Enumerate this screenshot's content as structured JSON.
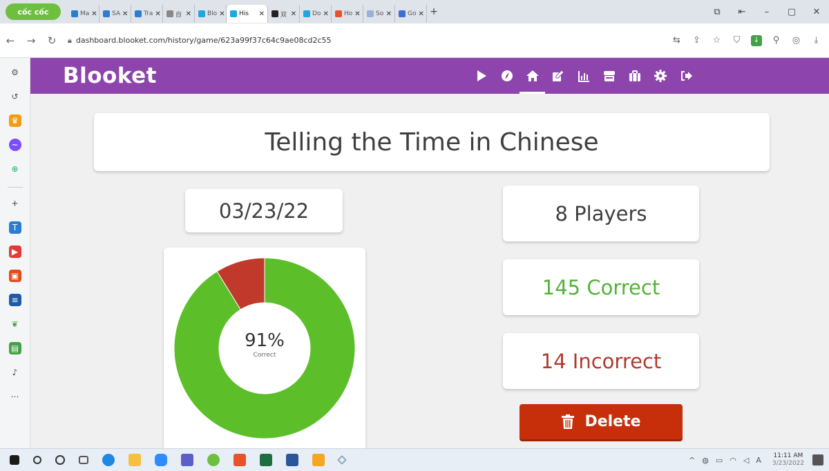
{
  "browser": {
    "logo_text": "cốc cốc",
    "tabs": [
      {
        "label": "Ma",
        "color": "#2b7cd3"
      },
      {
        "label": "SA",
        "color": "#2b7cd3"
      },
      {
        "label": "Tra",
        "color": "#2b7cd3"
      },
      {
        "label": "自",
        "color": "#888888"
      },
      {
        "label": "Blo",
        "color": "#1fa8e0"
      },
      {
        "label": "His",
        "color": "#1fa8e0",
        "active": true
      },
      {
        "label": "双",
        "color": "#222222"
      },
      {
        "label": "Do",
        "color": "#1fa8e0"
      },
      {
        "label": "Ho",
        "color": "#e8542a"
      },
      {
        "label": "So",
        "color": "#9ab0d8"
      },
      {
        "label": "Go",
        "color": "#3b6fd1"
      }
    ],
    "url": "dashboard.blooket.com/history/game/623a99f37c64c9ae08cd2c55"
  },
  "app": {
    "logo": "Blooket",
    "brand_color": "#8e44ad",
    "nav": [
      "play-icon",
      "discover-icon",
      "home-icon",
      "create-icon",
      "stats-icon",
      "market-icon",
      "blooks-icon",
      "settings-icon",
      "logout-icon"
    ]
  },
  "game": {
    "title": "Telling the Time in Chinese",
    "date": "03/23/22",
    "players": "8 Players",
    "correct": "145 Correct",
    "incorrect": "14 Incorrect",
    "percent": "91%",
    "percent_label": "Correct",
    "delete_label": "Delete"
  },
  "chart_data": {
    "type": "pie",
    "categories": [
      "Correct",
      "Incorrect"
    ],
    "values": [
      145,
      14
    ],
    "colors": [
      "#5cbf2a",
      "#c0392b"
    ]
  },
  "taskbar": {
    "time": "11:11 AM",
    "date": "3/23/2022"
  }
}
